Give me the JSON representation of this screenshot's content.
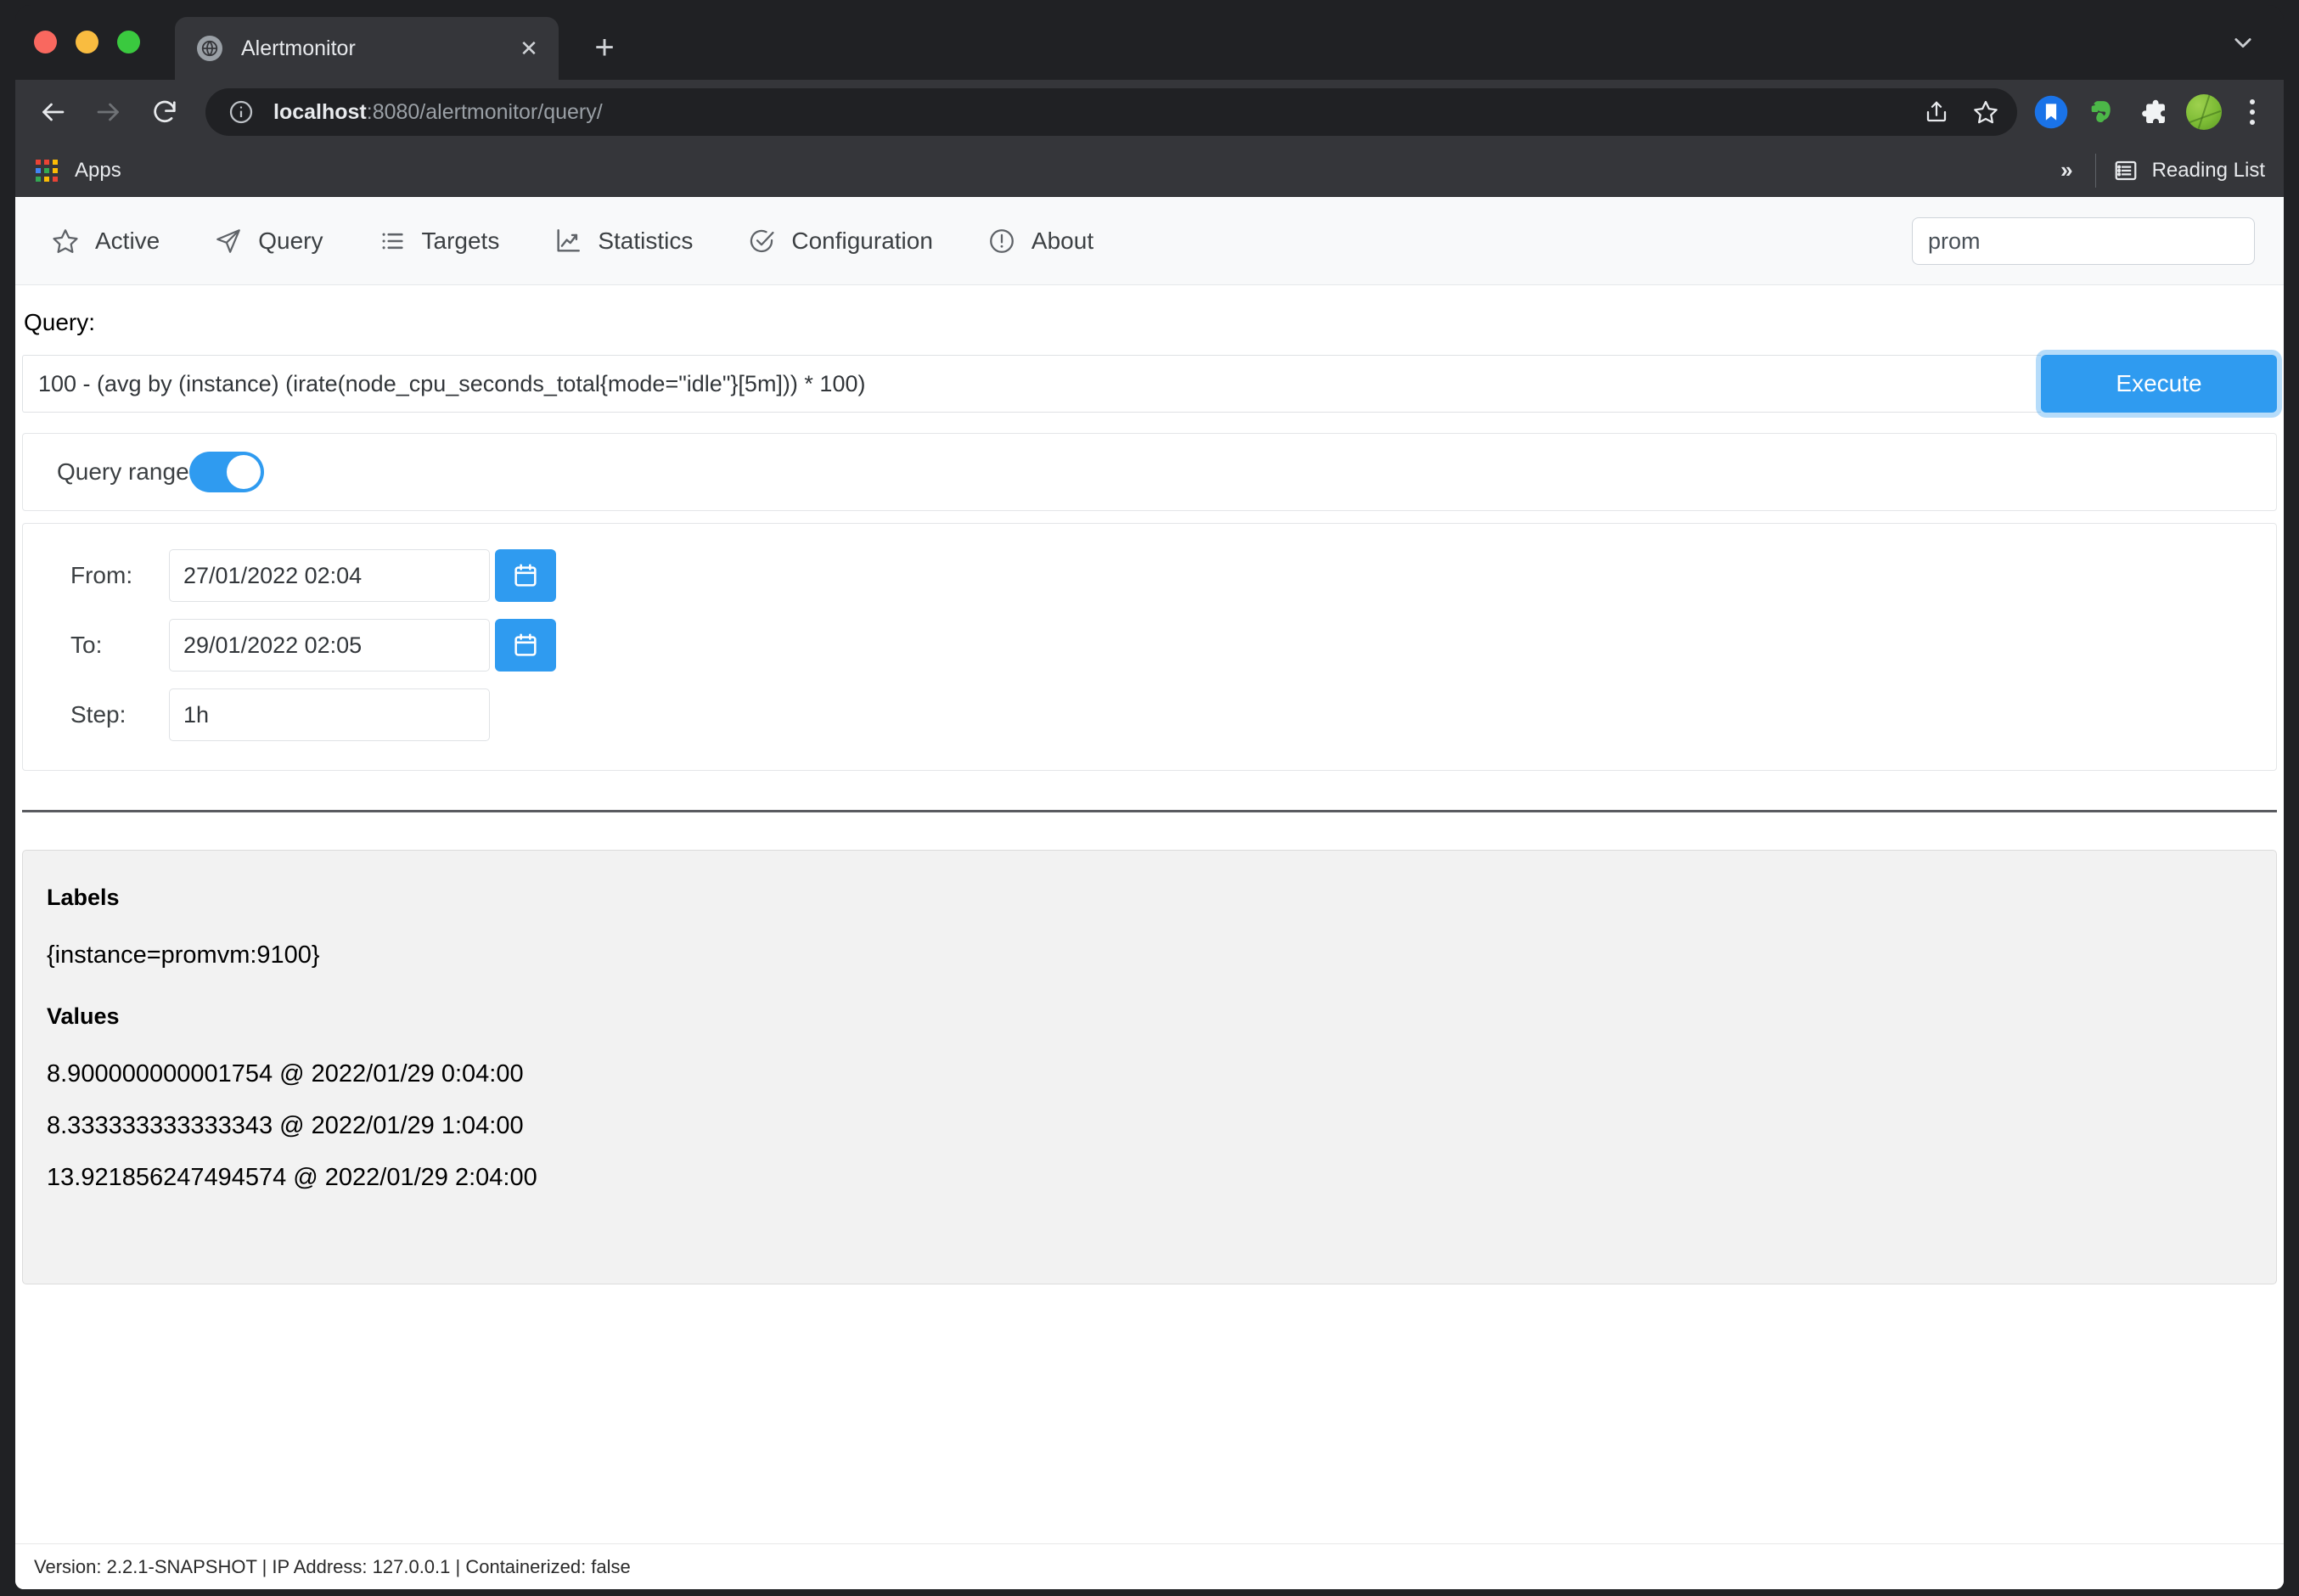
{
  "browser": {
    "tab": {
      "title": "Alertmonitor",
      "favicon_name": "globe-icon",
      "close_label": "✕"
    },
    "new_tab_label": "+",
    "toolbar": {
      "back_label": "←",
      "forward_label": "→",
      "reload_label": "⟳",
      "url_host": "localhost",
      "url_path": ":8080/alertmonitor/query/",
      "share_name": "share-icon",
      "bookmark_name": "star-icon",
      "ext_pocket_name": "bookmark-save-icon",
      "ext_evernote_name": "evernote-elephant-icon",
      "ext_puzzle_name": "extensions-puzzle-icon",
      "avatar_name": "profile-avatar",
      "menu_name": "kebab-menu-icon"
    },
    "bookmarks": {
      "apps_label": "Apps",
      "overflow_label": "»",
      "reading_list_label": "Reading List"
    }
  },
  "app": {
    "nav": [
      {
        "label": "Active",
        "icon": "star-icon"
      },
      {
        "label": "Query",
        "icon": "send-paper-plane-icon"
      },
      {
        "label": "Targets",
        "icon": "list-bullets-icon"
      },
      {
        "label": "Statistics",
        "icon": "line-chart-icon"
      },
      {
        "label": "Configuration",
        "icon": "check-circle-icon"
      },
      {
        "label": "About",
        "icon": "info-circle-icon"
      }
    ],
    "search": {
      "value": "prom",
      "placeholder": ""
    },
    "query": {
      "label": "Query:",
      "value": "100 - (avg by (instance) (irate(node_cpu_seconds_total{mode=\"idle\"}[5m])) * 100)",
      "placeholder": "",
      "execute_label": "Execute"
    },
    "range": {
      "toggle_label": "Query range",
      "toggle_on": "on",
      "from_label": "From:",
      "from_value": "27/01/2022 02:04",
      "to_label": "To:",
      "to_value": "29/01/2022 02:05",
      "step_label": "Step:",
      "step_value": "1h",
      "calendar_icon": "calendar-icon"
    },
    "results": {
      "labels_heading": "Labels",
      "labels_value": "{instance=promvm:9100}",
      "values_heading": "Values",
      "values": [
        "8.900000000001754 @ 2022/01/29 0:04:00",
        "8.333333333333343 @ 2022/01/29 1:04:00",
        "13.921856247494574 @ 2022/01/29 2:04:00"
      ]
    },
    "footer": {
      "text": "Version: 2.2.1-SNAPSHOT | IP Address: 127.0.0.1 | Containerized: false"
    }
  },
  "colors": {
    "accent_blue": "#2f9bf0",
    "chrome_dark": "#202124",
    "toolbar_dark": "#35363a",
    "panel_gray": "#f2f2f2",
    "nav_bg": "#f8f9fa"
  }
}
